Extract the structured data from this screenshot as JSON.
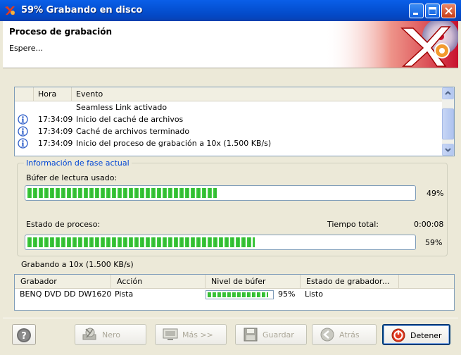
{
  "window": {
    "title": "59% Grabando en disco",
    "colors": {
      "titlebar": "#0553D6",
      "accent": "#0046D5",
      "progress": "#3FCF3F"
    }
  },
  "header": {
    "title": "Proceso de grabación",
    "subtitle": "Espere..."
  },
  "log": {
    "columns": [
      "Hora",
      "Evento"
    ],
    "rows": [
      {
        "icon": "",
        "time": "",
        "event": "Seamless Link activado"
      },
      {
        "icon": "info-icon",
        "time": "17:34:09",
        "event": "Inicio del caché de archivos"
      },
      {
        "icon": "info-icon",
        "time": "17:34:09",
        "event": "Caché de archivos terminado"
      },
      {
        "icon": "info-icon",
        "time": "17:34:09",
        "event": "Inicio del proceso de grabación a 10x (1.500 KB/s)"
      }
    ]
  },
  "phase": {
    "group_title": "Información de fase actual",
    "buffer_label": "Búfer de lectura usado:",
    "buffer_percent": 49,
    "buffer_percent_text": "49%",
    "process_label": "Estado de proceso:",
    "total_time_label": "Tiempo total:",
    "total_time": "0:00:08",
    "process_percent": 59,
    "process_percent_text": "59%"
  },
  "speed_text": "Grabando a 10x (1.500 KB/s)",
  "recorders": {
    "columns": [
      "Grabador",
      "Acción",
      "Nivel de búfer",
      "Estado de grabador",
      "..."
    ],
    "rows": [
      {
        "recorder": "BENQ DVD DD DW1620",
        "action": "Pista",
        "buffer_percent": 95,
        "buffer_text": "95%",
        "status": "Listo"
      }
    ]
  },
  "buttons": {
    "help": "",
    "nero": "Nero",
    "mas": "Más >>",
    "guardar": "Guardar",
    "atras": "Atrás",
    "detener": "Detener"
  }
}
